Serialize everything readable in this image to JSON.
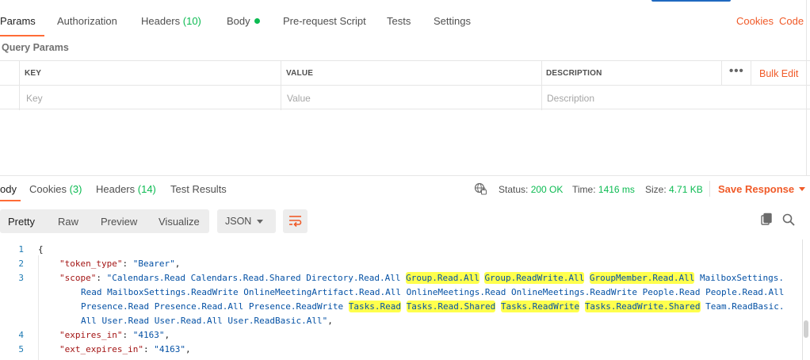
{
  "request_tabs": [
    {
      "label": "Params",
      "count": ""
    },
    {
      "label": "Authorization",
      "count": ""
    },
    {
      "label": "Headers",
      "count": "(10)"
    },
    {
      "label": "Body",
      "count": ""
    },
    {
      "label": "Pre-request Script",
      "count": ""
    },
    {
      "label": "Tests",
      "count": ""
    },
    {
      "label": "Settings",
      "count": ""
    }
  ],
  "request_links": {
    "cookies": "Cookies",
    "code": "Code"
  },
  "query_params": {
    "title": "Query Params",
    "columns": [
      "KEY",
      "VALUE",
      "DESCRIPTION"
    ],
    "placeholders": [
      "Key",
      "Value",
      "Description"
    ],
    "bulk_edit": "Bulk Edit",
    "more": "•••"
  },
  "response_tabs": [
    {
      "label": "ody",
      "count": ""
    },
    {
      "label": "Cookies",
      "count": "(3)"
    },
    {
      "label": "Headers",
      "count": "(14)"
    },
    {
      "label": "Test Results",
      "count": ""
    }
  ],
  "response_meta": {
    "status_label": "Status:",
    "status_value": "200 OK",
    "time_label": "Time:",
    "time_value": "1416 ms",
    "size_label": "Size:",
    "size_value": "4.71 KB",
    "save_response": "Save Response"
  },
  "body_view": {
    "modes": [
      "Pretty",
      "Raw",
      "Preview",
      "Visualize"
    ],
    "format": "JSON"
  },
  "code": {
    "line_numbers": [
      "1",
      "2",
      "3",
      "4",
      "5"
    ],
    "open_brace": "{",
    "token_type_key": "\"token_type\"",
    "token_type_value": "\"Bearer\"",
    "scope_key": "\"scope\"",
    "scope_parts": [
      "\"Calendars.Read Calendars.Read.Shared Directory.Read.All ",
      "Group.Read.All",
      " ",
      "Group.ReadWrite.All",
      " ",
      "GroupMember.Read.All",
      " MailboxSettings."
    ],
    "scope_line2": "Read MailboxSettings.ReadWrite OnlineMeetingArtifact.Read.All OnlineMeetings.Read OnlineMeetings.ReadWrite People.Read People.Read.All",
    "scope_line3_parts": [
      "Presence.Read Presence.Read.All Presence.ReadWrite ",
      "Tasks.Read",
      " ",
      "Tasks.Read.Shared",
      " ",
      "Tasks.ReadWrite",
      " ",
      "Tasks.ReadWrite.Shared",
      " Team.ReadBasic."
    ],
    "scope_line4": "All User.Read User.Read.All User.ReadBasic.All\"",
    "expires_in_key": "\"expires_in\"",
    "expires_in_value": "\"4163\"",
    "ext_expires_in_key": "\"ext_expires_in\"",
    "ext_expires_in_value": "\"4163\""
  },
  "colors": {
    "accent": "#f05a28",
    "success": "#0cbb52",
    "highlight": "#ffff4d"
  }
}
